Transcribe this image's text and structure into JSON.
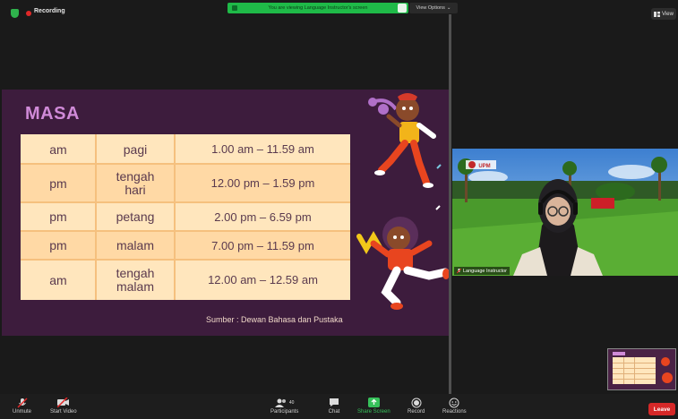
{
  "topbar": {
    "recording_label": "Recording",
    "banner_text": "You are viewing Language Instructor's screen",
    "view_options_label": "View Options",
    "view_label": "View"
  },
  "slide": {
    "title": "MASA",
    "rows": [
      {
        "c1": "am",
        "c2": [
          "pagi"
        ],
        "c3": "1.00 am – 11.59 am"
      },
      {
        "c1": "pm",
        "c2": [
          "tengah",
          "hari"
        ],
        "c3": "12.00 pm – 1.59 pm"
      },
      {
        "c1": "pm",
        "c2": [
          "petang"
        ],
        "c3": "2.00 pm – 6.59 pm"
      },
      {
        "c1": "pm",
        "c2": [
          "malam"
        ],
        "c3": "7.00 pm – 11.59 pm"
      },
      {
        "c1": "am",
        "c2": [
          "tengah",
          "malam"
        ],
        "c3": "12.00 am – 12.59 am"
      }
    ],
    "source": "Sumber : Dewan Bahasa dan Pustaka"
  },
  "video": {
    "name": "Language Instructor",
    "logo_text": "UPM"
  },
  "toolbar": {
    "unmute": "Unmute",
    "start_video": "Start Video",
    "participants": "Participants",
    "participants_count": "40",
    "chat": "Chat",
    "share_screen": "Share Screen",
    "record": "Record",
    "reactions": "Reactions",
    "leave": "Leave"
  },
  "colors": {
    "slide_bg": "#3d1c3d",
    "table_bg": "#ffe6bd",
    "title": "#d08ad8",
    "banner": "#1fba48",
    "leave": "#d62828",
    "share_icon": "#36c15a"
  }
}
